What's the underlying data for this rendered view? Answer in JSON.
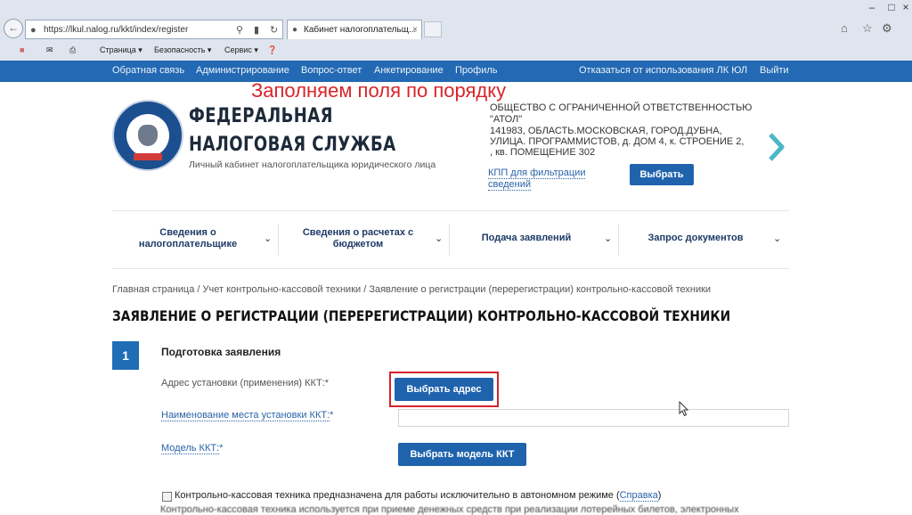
{
  "browser": {
    "url": "https://lkul.nalog.ru/kkt/index/register",
    "tab_title": "Кабинет налогоплательщ...",
    "command_bar": [
      "Страница ▾",
      "Безопасность ▾",
      "Сервис ▾"
    ]
  },
  "site_nav": {
    "items": [
      "Обратная связь",
      "Администрирование",
      "Вопрос-ответ",
      "Анкетирование",
      "Профиль"
    ],
    "right_items": [
      "Отказаться от использования ЛК ЮЛ",
      "Выйти"
    ]
  },
  "overlay_caption": "Заполняем поля по порядку",
  "header": {
    "title_line1": "ФЕДЕРАЛЬНАЯ",
    "title_line2": "НАЛОГОВАЯ СЛУЖБА",
    "subtitle": "Личный кабинет налогоплательщика юридического лица",
    "org_lines": [
      "ОБЩЕСТВО С ОГРАНИЧЕННОЙ ОТВЕТСТВЕННОСТЬЮ",
      "\"АТОЛ\"",
      "141983, ОБЛАСТЬ.МОСКОВСКАЯ, ГОРОД.ДУБНА,",
      "УЛИЦА. ПРОГРАММИСТОВ, д. ДОМ 4, к. СТРОЕНИЕ 2,",
      ", кв. ПОМЕЩЕНИЕ 302"
    ],
    "kpp_line1": "КПП для фильтрации",
    "kpp_line2": "сведений",
    "choose_button": "Выбрать"
  },
  "main_menu": [
    {
      "line1": "Сведения о",
      "line2": "налогоплательщике"
    },
    {
      "line1": "Сведения о расчетах с",
      "line2": "бюджетом"
    },
    {
      "line1": "Подача заявлений",
      "line2": ""
    },
    {
      "line1": "Запрос документов",
      "line2": ""
    }
  ],
  "breadcrumbs": "Главная страница / Учет контрольно-кассовой техники / Заявление о регистрации (перерегистрации) контрольно-кассовой техники",
  "page_title": "ЗАЯВЛЕНИЕ О РЕГИСТРАЦИИ (ПЕРЕРЕГИСТРАЦИИ) КОНТРОЛЬНО-КАССОВОЙ ТЕХНИКИ",
  "step": {
    "number": "1",
    "title": "Подготовка заявления"
  },
  "form": {
    "address_label": "Адрес установки (применения) ККТ:",
    "address_button": "Выбрать адрес",
    "place_label": "Наименование места установки ККТ:",
    "place_value": "",
    "model_label": "Модель ККТ:",
    "model_button": "Выбрать модель ККТ",
    "required_mark": "*",
    "checkbox1_text": "Контрольно-кассовая техника предназначена для работы исключительно в автономном режиме (",
    "checkbox1_link": "Справка",
    "checkbox1_close": ")",
    "checkbox2_text": "Контрольно-кассовая техника используется при приеме денежных средств при реализации лотерейных билетов, электронных"
  },
  "colors": {
    "nav_blue": "#2369b3",
    "button_blue": "#2063ad",
    "highlight_red": "#d6222b"
  }
}
